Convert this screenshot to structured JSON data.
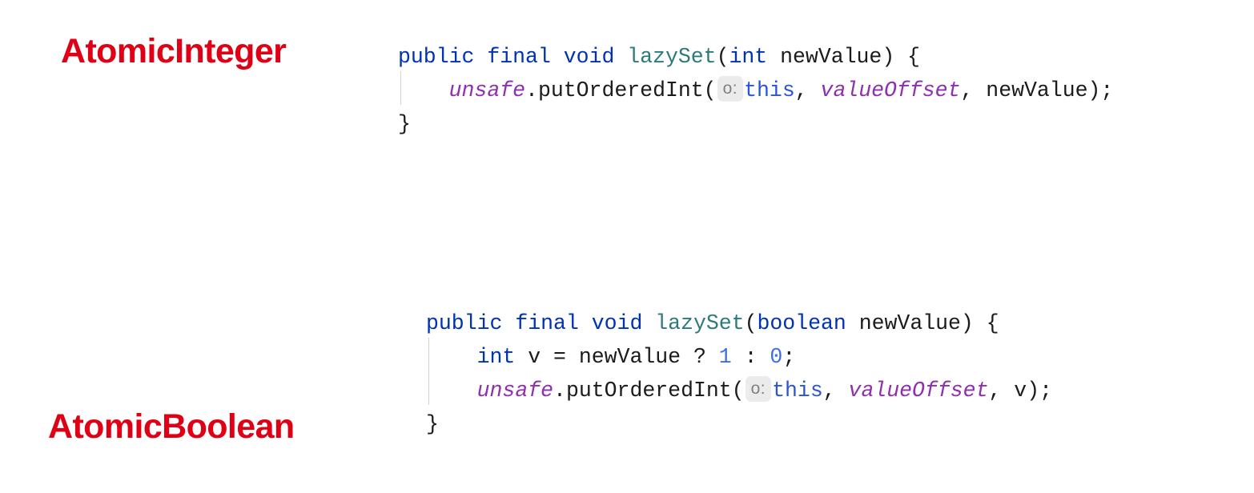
{
  "annotations": {
    "color": "#e00015",
    "integer_label": "AtomicInteger",
    "boolean_label": "AtomicBoolean"
  },
  "theme": {
    "background": "#ffffff",
    "keyword_color": "#0033b3",
    "method_color": "#2c7a7b",
    "field_color": "#8f2fb0",
    "this_color": "#2a55d6",
    "number_color": "#3b6dee",
    "text_color": "#1b1b1b",
    "hint_background": "#ebebeb",
    "hint_text_color": "#808080",
    "indent_guide_color": "#d2d2d2"
  },
  "code_blocks": [
    {
      "name": "AtomicInteger.lazySet",
      "lines": [
        {
          "indented": false,
          "tokens": [
            {
              "text": "public final void ",
              "type": "keyword"
            },
            {
              "text": "lazySet",
              "type": "method"
            },
            {
              "text": "(",
              "type": "plain"
            },
            {
              "text": "int",
              "type": "keyword"
            },
            {
              "text": " newValue) {",
              "type": "plain"
            }
          ]
        },
        {
          "indented": true,
          "tokens": [
            {
              "text": "    ",
              "type": "plain"
            },
            {
              "text": "unsafe",
              "type": "field"
            },
            {
              "text": ".putOrderedInt(",
              "type": "plain"
            },
            {
              "text": "o:",
              "type": "hint"
            },
            {
              "text": "this",
              "type": "this"
            },
            {
              "text": ", ",
              "type": "plain"
            },
            {
              "text": "valueOffset",
              "type": "field"
            },
            {
              "text": ", newValue);",
              "type": "plain"
            }
          ]
        },
        {
          "indented": false,
          "tokens": [
            {
              "text": "}",
              "type": "plain"
            }
          ]
        }
      ]
    },
    {
      "name": "AtomicBoolean.lazySet",
      "lines": [
        {
          "indented": false,
          "tokens": [
            {
              "text": "public final void ",
              "type": "keyword"
            },
            {
              "text": "lazySet",
              "type": "method"
            },
            {
              "text": "(",
              "type": "plain"
            },
            {
              "text": "boolean",
              "type": "keyword"
            },
            {
              "text": " newValue) {",
              "type": "plain"
            }
          ]
        },
        {
          "indented": true,
          "tokens": [
            {
              "text": "    ",
              "type": "plain"
            },
            {
              "text": "int",
              "type": "keyword"
            },
            {
              "text": " v = newValue ? ",
              "type": "plain"
            },
            {
              "text": "1",
              "type": "number"
            },
            {
              "text": " : ",
              "type": "plain"
            },
            {
              "text": "0",
              "type": "number"
            },
            {
              "text": ";",
              "type": "plain"
            }
          ]
        },
        {
          "indented": true,
          "tokens": [
            {
              "text": "    ",
              "type": "plain"
            },
            {
              "text": "unsafe",
              "type": "field"
            },
            {
              "text": ".putOrderedInt(",
              "type": "plain"
            },
            {
              "text": "o:",
              "type": "hint"
            },
            {
              "text": "this",
              "type": "this"
            },
            {
              "text": ", ",
              "type": "plain"
            },
            {
              "text": "valueOffset",
              "type": "field"
            },
            {
              "text": ", v);",
              "type": "plain"
            }
          ]
        },
        {
          "indented": false,
          "tokens": [
            {
              "text": "}",
              "type": "plain"
            }
          ]
        }
      ]
    }
  ]
}
